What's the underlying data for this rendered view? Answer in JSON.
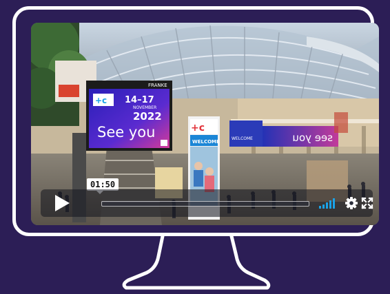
{
  "colors": {
    "background": "#2c1e56",
    "frame": "#ffffff",
    "accent": "#1aa3e8"
  },
  "player": {
    "time_label": "01:50",
    "progress": 0.0,
    "icons": {
      "play": "play-icon",
      "volume": "volume-bars-icon",
      "settings": "gear-icon",
      "fullscreen": "fullscreen-icon"
    }
  },
  "video_scene": {
    "billboard_brand": "FRANKE",
    "billboard_dates": "14–17",
    "billboard_month": "NOVEMBER",
    "billboard_year": "2022",
    "billboard_slogan": "See you",
    "pillar_sign": "WELCOME",
    "back_sign": "WELCOME"
  }
}
